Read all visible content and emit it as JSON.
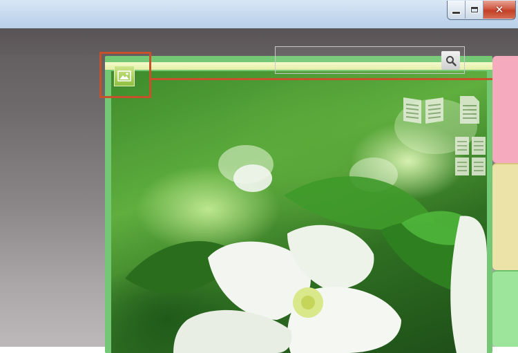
{
  "window": {
    "controls": {
      "minimize": "minimize-icon",
      "maximize": "maximize-icon",
      "close": "close-icon",
      "close_glyph": "✕"
    }
  },
  "search": {
    "value": "",
    "icon": "search-icon"
  },
  "photo_tag": {
    "icon": "image-icon",
    "highlighted": true
  },
  "view_modes": [
    "two-page-view",
    "single-page-view",
    "four-page-view"
  ],
  "side_tabs": [
    {
      "color": "#f6aabd"
    },
    {
      "color": "#ece3a8"
    },
    {
      "color": "#9ce59a"
    }
  ],
  "colors": {
    "frame": "#74c774",
    "highlight": "#c8502a"
  }
}
